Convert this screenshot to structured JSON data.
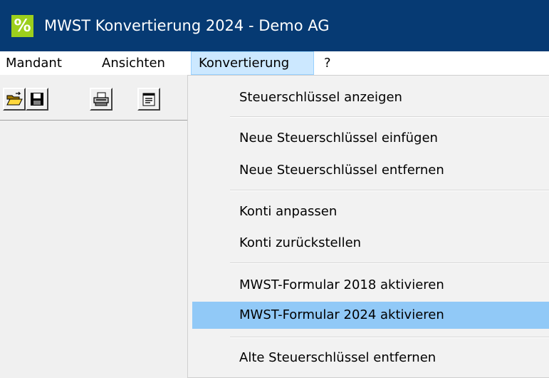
{
  "window": {
    "title": "MWST Konvertierung 2024 - Demo AG",
    "app_icon_glyph": "%",
    "app_icon_name": "percent-icon",
    "accent_color": "#063a73"
  },
  "menubar": {
    "items": [
      {
        "label": "Mandant"
      },
      {
        "label": "Ansichten"
      },
      {
        "label": "Konvertierung",
        "open": true
      },
      {
        "label": "?"
      }
    ]
  },
  "toolbar": {
    "buttons": [
      {
        "icon": "open-folder-icon"
      },
      {
        "icon": "save-icon"
      },
      {
        "icon": "print-icon"
      },
      {
        "icon": "properties-icon"
      }
    ]
  },
  "dropdown": {
    "items": [
      {
        "label": "Steuerschlüssel anzeigen"
      },
      {
        "label": "Neue Steuerschlüssel einfügen"
      },
      {
        "label": "Neue Steuerschlüssel entfernen"
      },
      {
        "label": "Konti anpassen"
      },
      {
        "label": "Konti zurückstellen"
      },
      {
        "label": "MWST-Formular 2018 aktivieren"
      },
      {
        "label": "MWST-Formular 2024 aktivieren",
        "highlighted": true
      },
      {
        "label": "Alte Steuerschlüssel entfernen"
      }
    ],
    "highlight_color": "#91c9f7"
  }
}
